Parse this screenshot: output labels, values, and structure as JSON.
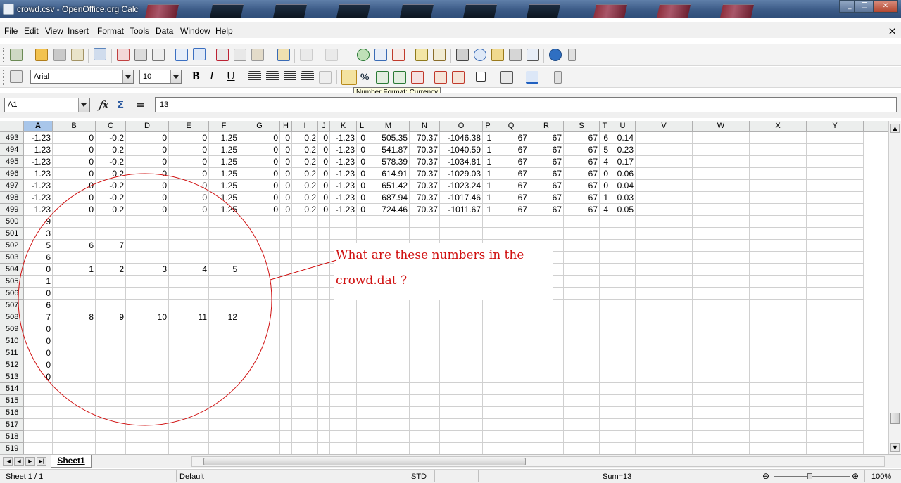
{
  "window": {
    "title": "crowd.csv - OpenOffice.org Calc",
    "controls": [
      "_",
      "❐",
      "✕"
    ]
  },
  "menu": {
    "items": [
      "File",
      "Edit",
      "View",
      "Insert",
      "Format",
      "Tools",
      "Data",
      "Window",
      "Help"
    ],
    "close": "×"
  },
  "toolbar": {
    "font_name": "Arial",
    "font_size": "10",
    "bold": "B",
    "italic": "I",
    "underline": "U",
    "percent": "%"
  },
  "tooltip": "Number Format: Currency",
  "formula": {
    "cell_ref": "A1",
    "value": "13",
    "fx": "𝑓x",
    "sum": "Σ",
    "equals": "="
  },
  "grid": {
    "columns": [
      "A",
      "B",
      "C",
      "D",
      "E",
      "F",
      "G",
      "H",
      "I",
      "J",
      "K",
      "L",
      "M",
      "N",
      "O",
      "P",
      "Q",
      "R",
      "S",
      "T",
      "U",
      "V",
      "W",
      "X",
      "Y"
    ],
    "selected_column": "A",
    "rows": [
      {
        "n": "493",
        "cells": [
          "-1.23",
          "0",
          "-0.2",
          "0",
          "0",
          "1.25",
          "0",
          "0",
          "0.2",
          "0",
          "-1.23",
          "0",
          "505.35",
          "70.37",
          "-1046.38",
          "1",
          "67",
          "67",
          "67",
          "6",
          "0.14",
          "",
          "",
          "",
          ""
        ]
      },
      {
        "n": "494",
        "cells": [
          "1.23",
          "0",
          "0.2",
          "0",
          "0",
          "1.25",
          "0",
          "0",
          "0.2",
          "0",
          "-1.23",
          "0",
          "541.87",
          "70.37",
          "-1040.59",
          "1",
          "67",
          "67",
          "67",
          "5",
          "0.23",
          "",
          "",
          "",
          ""
        ]
      },
      {
        "n": "495",
        "cells": [
          "-1.23",
          "0",
          "-0.2",
          "0",
          "0",
          "1.25",
          "0",
          "0",
          "0.2",
          "0",
          "-1.23",
          "0",
          "578.39",
          "70.37",
          "-1034.81",
          "1",
          "67",
          "67",
          "67",
          "4",
          "0.17",
          "",
          "",
          "",
          ""
        ]
      },
      {
        "n": "496",
        "cells": [
          "1.23",
          "0",
          "0.2",
          "0",
          "0",
          "1.25",
          "0",
          "0",
          "0.2",
          "0",
          "-1.23",
          "0",
          "614.91",
          "70.37",
          "-1029.03",
          "1",
          "67",
          "67",
          "67",
          "0",
          "0.06",
          "",
          "",
          "",
          ""
        ]
      },
      {
        "n": "497",
        "cells": [
          "-1.23",
          "0",
          "-0.2",
          "0",
          "0",
          "1.25",
          "0",
          "0",
          "0.2",
          "0",
          "-1.23",
          "0",
          "651.42",
          "70.37",
          "-1023.24",
          "1",
          "67",
          "67",
          "67",
          "0",
          "0.04",
          "",
          "",
          "",
          ""
        ]
      },
      {
        "n": "498",
        "cells": [
          "-1.23",
          "0",
          "-0.2",
          "0",
          "0",
          "1.25",
          "0",
          "0",
          "0.2",
          "0",
          "-1.23",
          "0",
          "687.94",
          "70.37",
          "-1017.46",
          "1",
          "67",
          "67",
          "67",
          "1",
          "0.03",
          "",
          "",
          "",
          ""
        ]
      },
      {
        "n": "499",
        "cells": [
          "1.23",
          "0",
          "0.2",
          "0",
          "0",
          "1.25",
          "0",
          "0",
          "0.2",
          "0",
          "-1.23",
          "0",
          "724.46",
          "70.37",
          "-1011.67",
          "1",
          "67",
          "67",
          "67",
          "4",
          "0.05",
          "",
          "",
          "",
          ""
        ]
      },
      {
        "n": "500",
        "cells": [
          "9",
          "",
          "",
          "",
          "",
          "",
          "",
          "",
          "",
          "",
          "",
          "",
          "",
          "",
          "",
          "",
          "",
          "",
          "",
          "",
          "",
          "",
          "",
          "",
          ""
        ]
      },
      {
        "n": "501",
        "cells": [
          "3",
          "",
          "",
          "",
          "",
          "",
          "",
          "",
          "",
          "",
          "",
          "",
          "",
          "",
          "",
          "",
          "",
          "",
          "",
          "",
          "",
          "",
          "",
          "",
          ""
        ]
      },
      {
        "n": "502",
        "cells": [
          "5",
          "6",
          "7",
          "",
          "",
          "",
          "",
          "",
          "",
          "",
          "",
          "",
          "",
          "",
          "",
          "",
          "",
          "",
          "",
          "",
          "",
          "",
          "",
          "",
          ""
        ]
      },
      {
        "n": "503",
        "cells": [
          "6",
          "",
          "",
          "",
          "",
          "",
          "",
          "",
          "",
          "",
          "",
          "",
          "",
          "",
          "",
          "",
          "",
          "",
          "",
          "",
          "",
          "",
          "",
          "",
          ""
        ]
      },
      {
        "n": "504",
        "cells": [
          "0",
          "1",
          "2",
          "3",
          "4",
          "5",
          "",
          "",
          "",
          "",
          "",
          "",
          "",
          "",
          "",
          "",
          "",
          "",
          "",
          "",
          "",
          "",
          "",
          "",
          ""
        ]
      },
      {
        "n": "505",
        "cells": [
          "1",
          "",
          "",
          "",
          "",
          "",
          "",
          "",
          "",
          "",
          "",
          "",
          "",
          "",
          "",
          "",
          "",
          "",
          "",
          "",
          "",
          "",
          "",
          "",
          ""
        ]
      },
      {
        "n": "506",
        "cells": [
          "0",
          "",
          "",
          "",
          "",
          "",
          "",
          "",
          "",
          "",
          "",
          "",
          "",
          "",
          "",
          "",
          "",
          "",
          "",
          "",
          "",
          "",
          "",
          "",
          ""
        ]
      },
      {
        "n": "507",
        "cells": [
          "6",
          "",
          "",
          "",
          "",
          "",
          "",
          "",
          "",
          "",
          "",
          "",
          "",
          "",
          "",
          "",
          "",
          "",
          "",
          "",
          "",
          "",
          "",
          "",
          ""
        ]
      },
      {
        "n": "508",
        "cells": [
          "7",
          "8",
          "9",
          "10",
          "11",
          "12",
          "",
          "",
          "",
          "",
          "",
          "",
          "",
          "",
          "",
          "",
          "",
          "",
          "",
          "",
          "",
          "",
          "",
          "",
          ""
        ]
      },
      {
        "n": "509",
        "cells": [
          "0",
          "",
          "",
          "",
          "",
          "",
          "",
          "",
          "",
          "",
          "",
          "",
          "",
          "",
          "",
          "",
          "",
          "",
          "",
          "",
          "",
          "",
          "",
          "",
          ""
        ]
      },
      {
        "n": "510",
        "cells": [
          "0",
          "",
          "",
          "",
          "",
          "",
          "",
          "",
          "",
          "",
          "",
          "",
          "",
          "",
          "",
          "",
          "",
          "",
          "",
          "",
          "",
          "",
          "",
          "",
          ""
        ]
      },
      {
        "n": "511",
        "cells": [
          "0",
          "",
          "",
          "",
          "",
          "",
          "",
          "",
          "",
          "",
          "",
          "",
          "",
          "",
          "",
          "",
          "",
          "",
          "",
          "",
          "",
          "",
          "",
          "",
          ""
        ]
      },
      {
        "n": "512",
        "cells": [
          "0",
          "",
          "",
          "",
          "",
          "",
          "",
          "",
          "",
          "",
          "",
          "",
          "",
          "",
          "",
          "",
          "",
          "",
          "",
          "",
          "",
          "",
          "",
          "",
          ""
        ]
      },
      {
        "n": "513",
        "cells": [
          "0",
          "",
          "",
          "",
          "",
          "",
          "",
          "",
          "",
          "",
          "",
          "",
          "",
          "",
          "",
          "",
          "",
          "",
          "",
          "",
          "",
          "",
          "",
          "",
          ""
        ]
      },
      {
        "n": "514",
        "cells": [
          "",
          "",
          "",
          "",
          "",
          "",
          "",
          "",
          "",
          "",
          "",
          "",
          "",
          "",
          "",
          "",
          "",
          "",
          "",
          "",
          "",
          "",
          "",
          "",
          ""
        ]
      },
      {
        "n": "515",
        "cells": [
          "",
          "",
          "",
          "",
          "",
          "",
          "",
          "",
          "",
          "",
          "",
          "",
          "",
          "",
          "",
          "",
          "",
          "",
          "",
          "",
          "",
          "",
          "",
          "",
          ""
        ]
      },
      {
        "n": "516",
        "cells": [
          "",
          "",
          "",
          "",
          "",
          "",
          "",
          "",
          "",
          "",
          "",
          "",
          "",
          "",
          "",
          "",
          "",
          "",
          "",
          "",
          "",
          "",
          "",
          "",
          ""
        ]
      },
      {
        "n": "517",
        "cells": [
          "",
          "",
          "",
          "",
          "",
          "",
          "",
          "",
          "",
          "",
          "",
          "",
          "",
          "",
          "",
          "",
          "",
          "",
          "",
          "",
          "",
          "",
          "",
          "",
          ""
        ]
      },
      {
        "n": "518",
        "cells": [
          "",
          "",
          "",
          "",
          "",
          "",
          "",
          "",
          "",
          "",
          "",
          "",
          "",
          "",
          "",
          "",
          "",
          "",
          "",
          "",
          "",
          "",
          "",
          "",
          ""
        ]
      },
      {
        "n": "519",
        "cells": [
          "",
          "",
          "",
          "",
          "",
          "",
          "",
          "",
          "",
          "",
          "",
          "",
          "",
          "",
          "",
          "",
          "",
          "",
          "",
          "",
          "",
          "",
          "",
          "",
          ""
        ]
      }
    ]
  },
  "annotation": {
    "line1": "What are these numbers in the",
    "line2": "crowd.dat ?",
    "color": "#d01010"
  },
  "sheets": {
    "active": "Sheet1"
  },
  "status": {
    "sheet": "Sheet 1 / 1",
    "style": "Default",
    "mode": "STD",
    "sum": "Sum=13",
    "zoom": "100%"
  }
}
